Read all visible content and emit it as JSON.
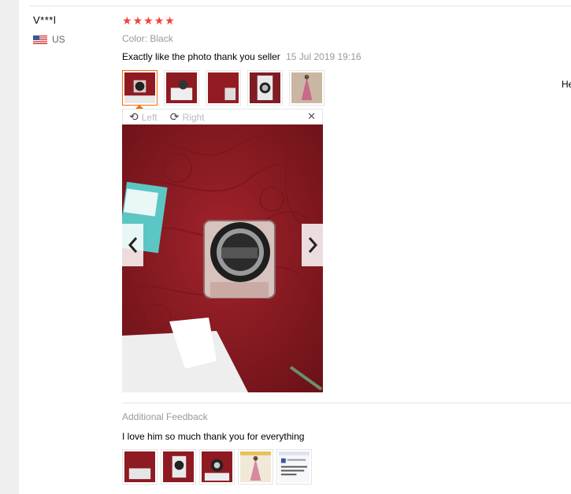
{
  "review": {
    "user_name": "V***l",
    "country": "US",
    "rating": 5,
    "color_label": "Color: Black",
    "text": "Exactly like the photo thank you seller",
    "date": "15 Jul 2019 19:16"
  },
  "cut_off_text": "He",
  "thumbnails": [
    {
      "name": "thumb-ring-light-box",
      "active": true
    },
    {
      "name": "thumb-ring-light-packaging",
      "active": false
    },
    {
      "name": "thumb-red-fabric",
      "active": false
    },
    {
      "name": "thumb-ring-light-on-phone",
      "active": false
    },
    {
      "name": "thumb-pink-dress",
      "active": false
    }
  ],
  "viewer": {
    "rotate_left_label": "Left",
    "rotate_right_label": "Right"
  },
  "icons": {
    "flag": "us-flag-icon",
    "star": "star-icon",
    "rotate_left": "rotate-left-icon",
    "rotate_right": "rotate-right-icon",
    "close": "close-icon",
    "prev": "chevron-left-icon",
    "next": "chevron-right-icon"
  },
  "additional_feedback": {
    "title": "Additional Feedback",
    "text": "I love him so much thank you for everything",
    "thumbnails": [
      "red-fabric-photo",
      "ring-light-phone-photo",
      "ring-light-closeup-photo",
      "dress-collage-photo",
      "screenshot-photo"
    ]
  },
  "colors": {
    "star": "#f44336",
    "active_border": "#ff6a00",
    "muted_text": "#999999"
  }
}
